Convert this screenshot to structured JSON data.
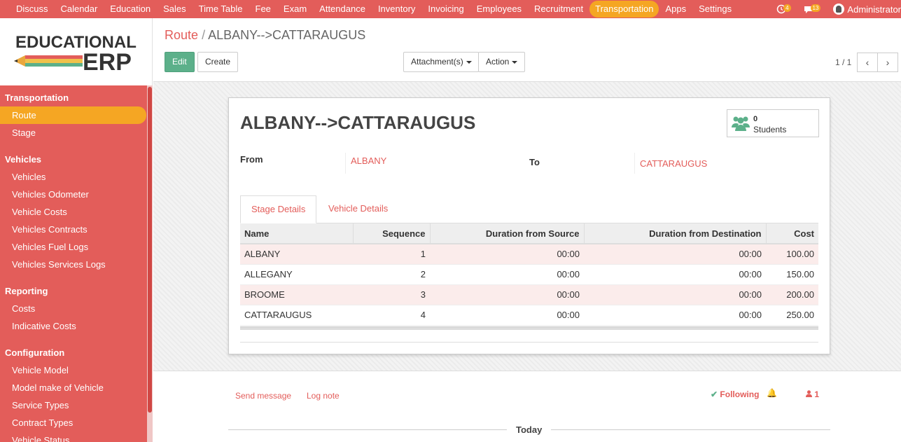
{
  "topnav": {
    "items": [
      "Discuss",
      "Calendar",
      "Education",
      "Sales",
      "Time Table",
      "Fee",
      "Exam",
      "Attendance",
      "Inventory",
      "Invoicing",
      "Employees",
      "Recruitment",
      "Transportation",
      "Apps",
      "Settings"
    ],
    "active_index": 12,
    "activity_count": "4",
    "message_count": "13",
    "user_name": "Administrator"
  },
  "logo": {
    "line1": "EDUCATIONAL",
    "line2": "ERP"
  },
  "sidebar": {
    "sections": [
      {
        "title": "Transportation",
        "items": [
          "Route",
          "Stage"
        ]
      },
      {
        "title": "Vehicles",
        "items": [
          "Vehicles",
          "Vehicles Odometer",
          "Vehicle Costs",
          "Vehicles Contracts",
          "Vehicles Fuel Logs",
          "Vehicles Services Logs"
        ]
      },
      {
        "title": "Reporting",
        "items": [
          "Costs",
          "Indicative Costs"
        ]
      },
      {
        "title": "Configuration",
        "items": [
          "Vehicle Model",
          "Model make of Vehicle",
          "Service Types",
          "Contract Types",
          "Vehicle Status"
        ]
      }
    ],
    "active_item": "Route"
  },
  "breadcrumb": {
    "parent": "Route",
    "separator": "/",
    "current": "ALBANY-->CATTARAUGUS"
  },
  "buttons": {
    "edit": "Edit",
    "create": "Create",
    "attachments": "Attachment(s)",
    "action": "Action"
  },
  "pager": {
    "text": "1 / 1"
  },
  "record": {
    "title": "ALBANY-->CATTARAUGUS",
    "students_count": "0",
    "students_label": "Students",
    "from_label": "From",
    "from_value": "ALBANY",
    "to_label": "To",
    "to_value": "CATTARAUGUS"
  },
  "tabs": [
    "Stage Details",
    "Vehicle Details"
  ],
  "stage_table": {
    "columns": [
      "Name",
      "Sequence",
      "Duration from Source",
      "Duration from Destination",
      "Cost"
    ],
    "rows": [
      [
        "ALBANY",
        "1",
        "00:00",
        "00:00",
        "100.00"
      ],
      [
        "ALLEGANY",
        "2",
        "00:00",
        "00:00",
        "150.00"
      ],
      [
        "BROOME",
        "3",
        "00:00",
        "00:00",
        "200.00"
      ],
      [
        "CATTARAUGUS",
        "4",
        "00:00",
        "00:00",
        "250.00"
      ]
    ]
  },
  "chatter": {
    "send_message": "Send message",
    "log_note": "Log note",
    "following": "Following",
    "followers_count": "1",
    "today": "Today"
  },
  "colors": {
    "brand": "#e35d5a",
    "accent": "#f5a623",
    "primary_button": "#5cb08a"
  }
}
